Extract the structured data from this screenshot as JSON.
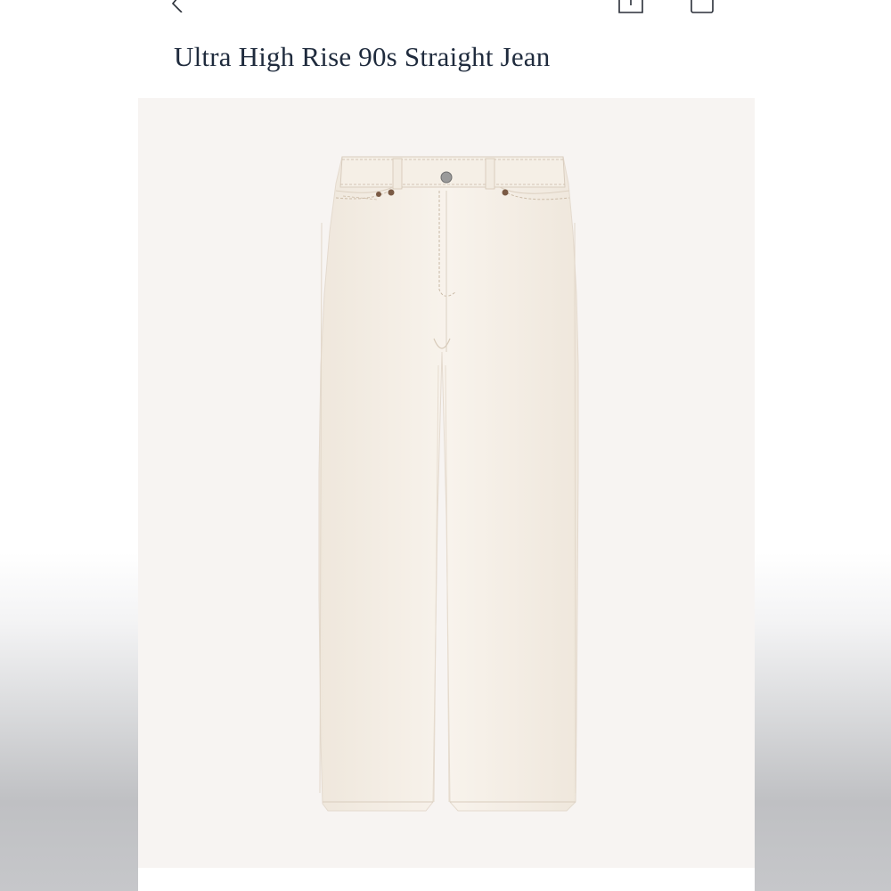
{
  "product": {
    "title": "Ultra High Rise 90s Straight Jean"
  },
  "toolbar": {
    "back_icon": "chevron-left-icon",
    "share_icon": "share-icon",
    "bag_icon": "shopping-bag-icon"
  },
  "colors": {
    "title_text": "#1f2b3d",
    "image_background": "#f7f4f2",
    "garment": "#f6f0e8"
  }
}
